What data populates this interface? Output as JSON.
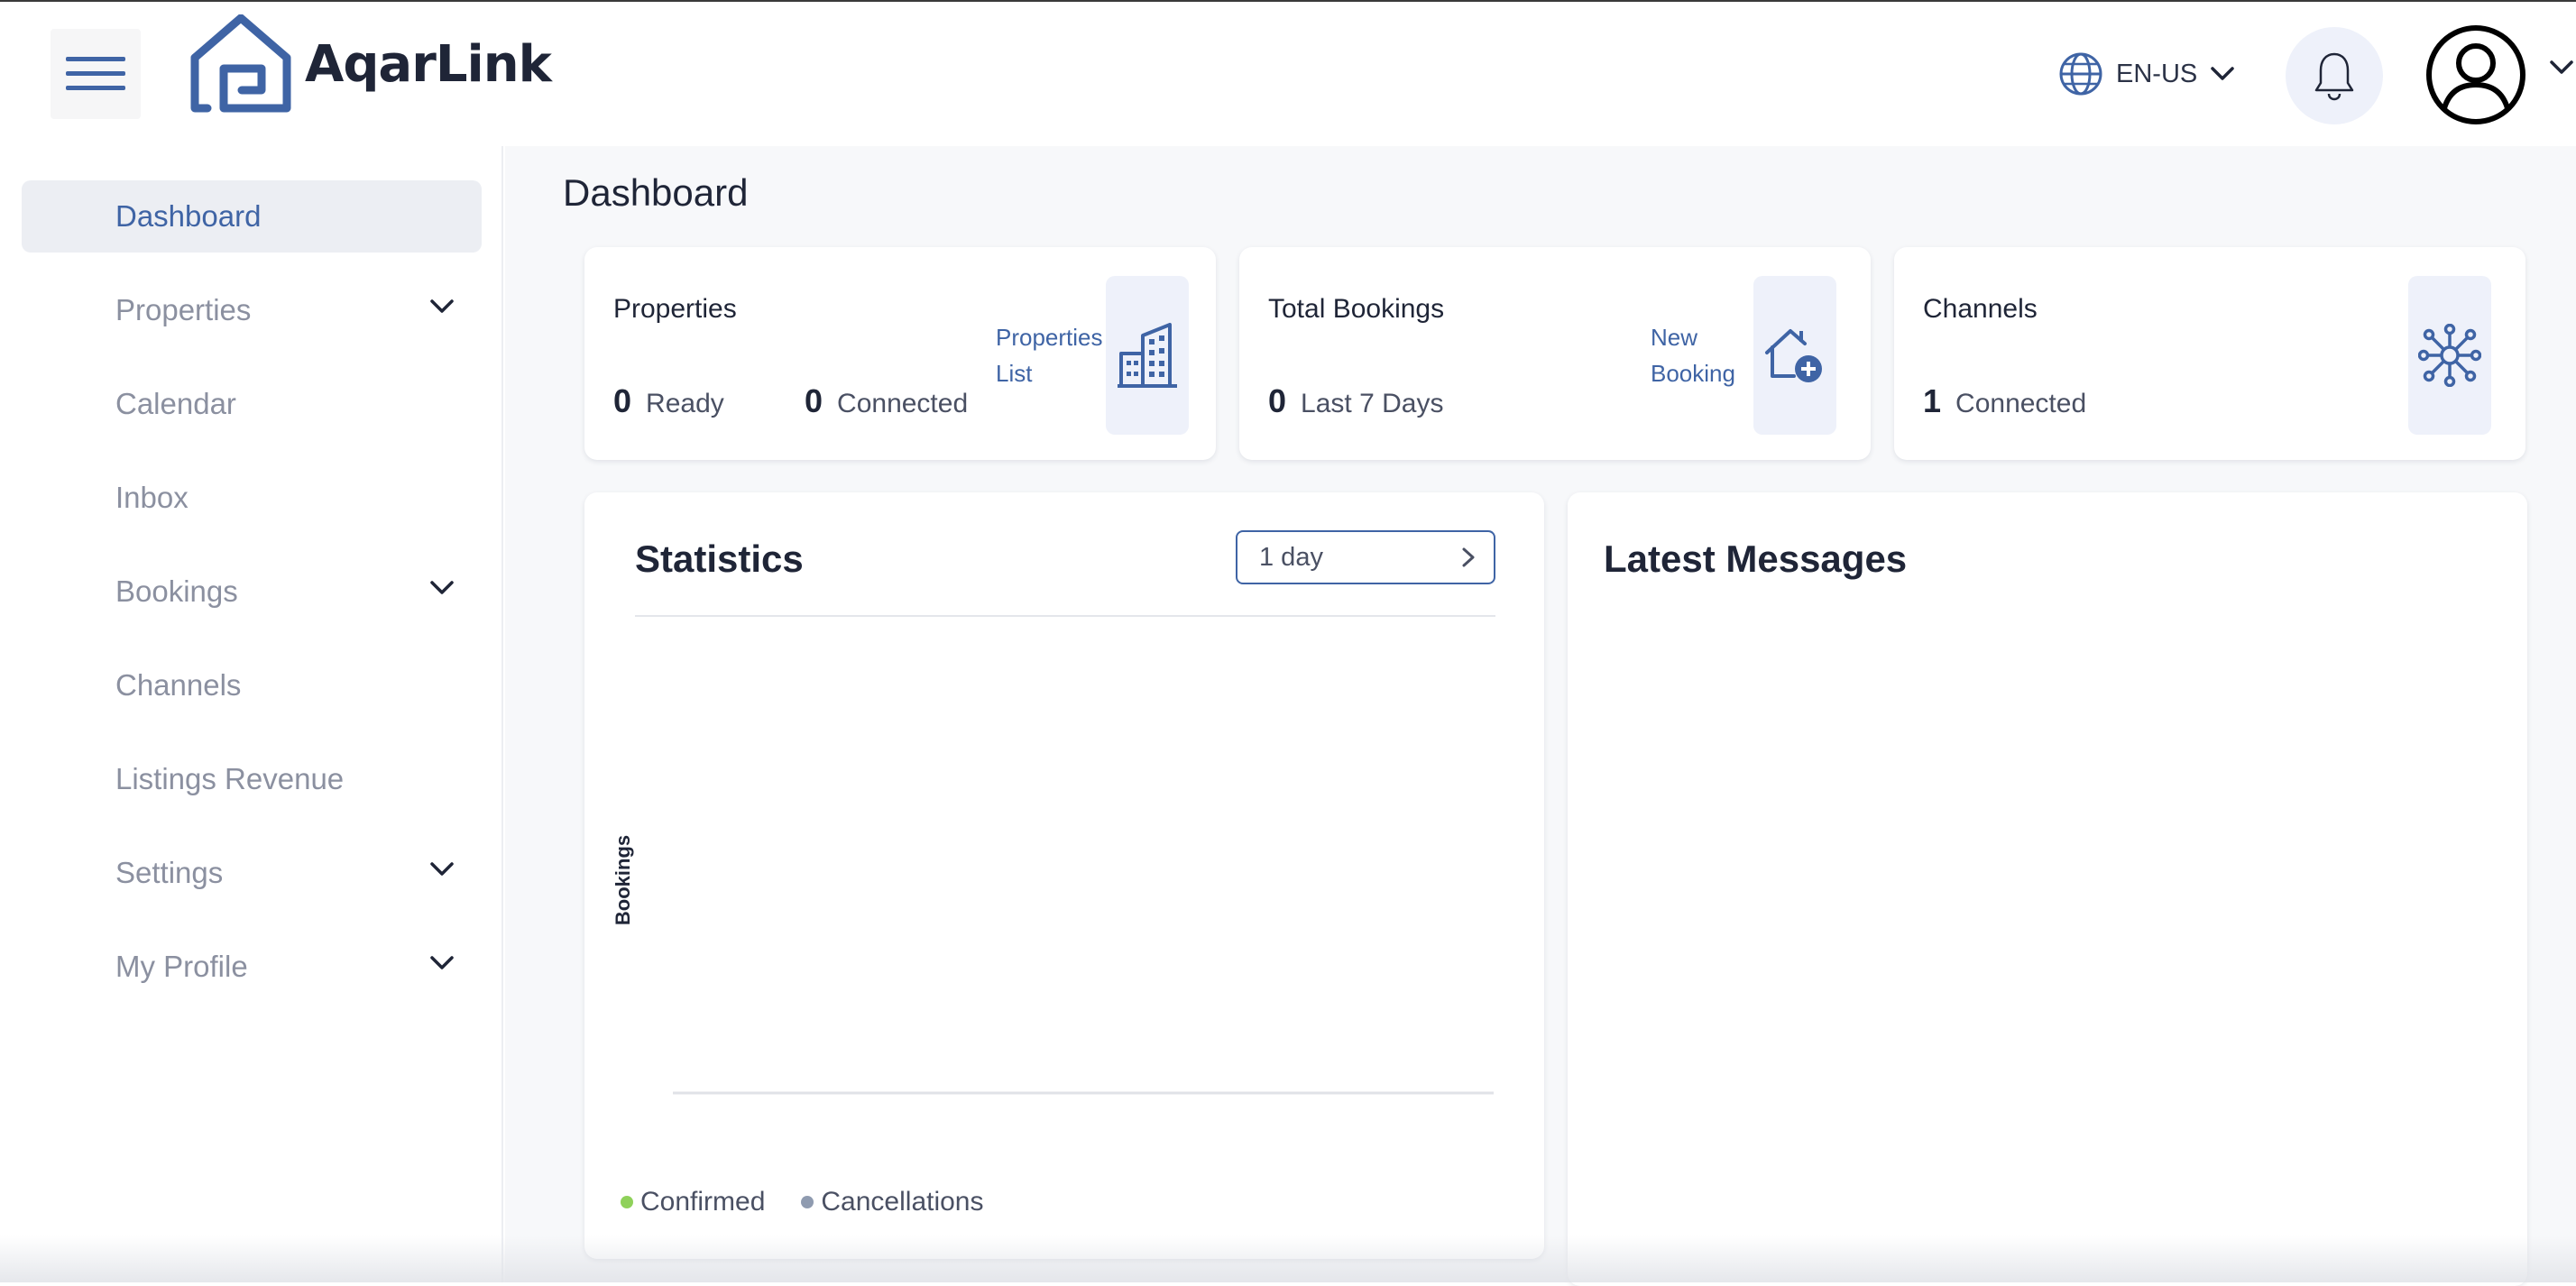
{
  "app": {
    "name": "AqarLink"
  },
  "header": {
    "language": "EN-US"
  },
  "sidebar": {
    "items": [
      {
        "label": "Dashboard",
        "active": true,
        "expandable": false
      },
      {
        "label": "Properties",
        "active": false,
        "expandable": true
      },
      {
        "label": "Calendar",
        "active": false,
        "expandable": false
      },
      {
        "label": "Inbox",
        "active": false,
        "expandable": false
      },
      {
        "label": "Bookings",
        "active": false,
        "expandable": true
      },
      {
        "label": "Channels",
        "active": false,
        "expandable": false
      },
      {
        "label": "Listings Revenue",
        "active": false,
        "expandable": false
      },
      {
        "label": "Settings",
        "active": false,
        "expandable": true
      },
      {
        "label": "My Profile",
        "active": false,
        "expandable": true
      }
    ]
  },
  "main": {
    "title": "Dashboard",
    "cards": {
      "properties": {
        "title": "Properties",
        "ready_value": "0",
        "ready_label": "Ready",
        "connected_value": "0",
        "connected_label": "Connected",
        "link_line1": "Properties",
        "link_line2": "List",
        "icon": "building-icon"
      },
      "bookings": {
        "title": "Total Bookings",
        "value": "0",
        "label": "Last 7 Days",
        "link_line1": "New",
        "link_line2": "Booking",
        "icon": "house-plus-icon"
      },
      "channels": {
        "title": "Channels",
        "value": "1",
        "label": "Connected",
        "icon": "network-icon"
      }
    },
    "statistics": {
      "title": "Statistics",
      "range": "1 day",
      "y_label": "Bookings",
      "legend": [
        {
          "label": "Confirmed",
          "color": "#8fd15a"
        },
        {
          "label": "Cancellations",
          "color": "#8f9bb0"
        }
      ]
    },
    "messages": {
      "title": "Latest Messages"
    }
  },
  "colors": {
    "accent": "#3f64a5",
    "icon_bg": "#eef1fa",
    "sidebar_active_bg": "#eceef3"
  }
}
